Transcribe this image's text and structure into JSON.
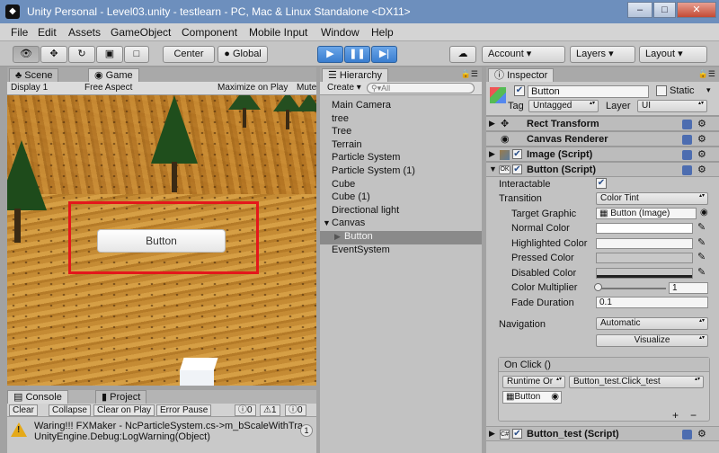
{
  "window": {
    "title": "Unity Personal - Level03.unity - testlearn - PC, Mac & Linux Standalone <DX11>",
    "minimize": "–",
    "maximize": "□",
    "close": "✕"
  },
  "menu": [
    "File",
    "Edit",
    "Assets",
    "GameObject",
    "Component",
    "Mobile Input",
    "Window",
    "Help"
  ],
  "toolbar": {
    "center": "Center",
    "global": "Global",
    "account": "Account",
    "layers": "Layers",
    "layout": "Layout"
  },
  "tabs": {
    "scene": "Scene",
    "game": "Game",
    "hierarchy": "Hierarchy",
    "inspector": "Inspector",
    "console": "Console",
    "project": "Project"
  },
  "game_toolbar": {
    "display": "Display 1",
    "aspect": "Free Aspect",
    "maximize": "Maximize on Play",
    "mute": "Mute"
  },
  "game_view": {
    "button_text": "Button"
  },
  "console": {
    "clear": "Clear",
    "collapse": "Collapse",
    "clear_on_play": "Clear on Play",
    "error_pause": "Error Pause",
    "errors": "0",
    "warnings": "1",
    "logs": "0",
    "line1": "Waring!!! FXMaker - NcParticleSystem.cs->m_bScaleWithTra",
    "line2": "UnityEngine.Debug:LogWarning(Object)",
    "count": "1"
  },
  "hierarchy": {
    "create": "Create",
    "search_placeholder": "All",
    "items": [
      "Main Camera",
      "tree",
      "Tree",
      "Terrain",
      "Particle System",
      "Particle System (1)",
      "Cube",
      "Cube (1)",
      "Directional light",
      "Canvas",
      "Button",
      "EventSystem"
    ]
  },
  "inspector": {
    "object_name": "Button",
    "static_label": "Static",
    "tag_label": "Tag",
    "tag_value": "Untagged",
    "layer_label": "Layer",
    "layer_value": "UI",
    "components": {
      "rect_transform": "Rect Transform",
      "canvas_renderer": "Canvas Renderer",
      "image": "Image (Script)",
      "button": "Button (Script)",
      "button_test": "Button_test (Script)"
    },
    "props": {
      "interactable": "Interactable",
      "transition": "Transition",
      "transition_value": "Color Tint",
      "target_graphic": "Target Graphic",
      "target_graphic_value": "Button (Image)",
      "normal_color": "Normal Color",
      "highlighted_color": "Highlighted Color",
      "pressed_color": "Pressed Color",
      "disabled_color": "Disabled Color",
      "color_multiplier": "Color Multiplier",
      "color_multiplier_value": "1",
      "fade_duration": "Fade Duration",
      "fade_duration_value": "0.1",
      "navigation": "Navigation",
      "navigation_value": "Automatic",
      "visualize": "Visualize"
    },
    "on_click": {
      "header": "On Click ()",
      "runtime": "Runtime Or",
      "function": "Button_test.Click_test",
      "target": "Button",
      "add": "+",
      "remove": "−"
    }
  },
  "colors": {
    "title_bar": "#6d8fbd",
    "play_blue": "#3a7ed0",
    "highlight_red": "#e4171b"
  }
}
